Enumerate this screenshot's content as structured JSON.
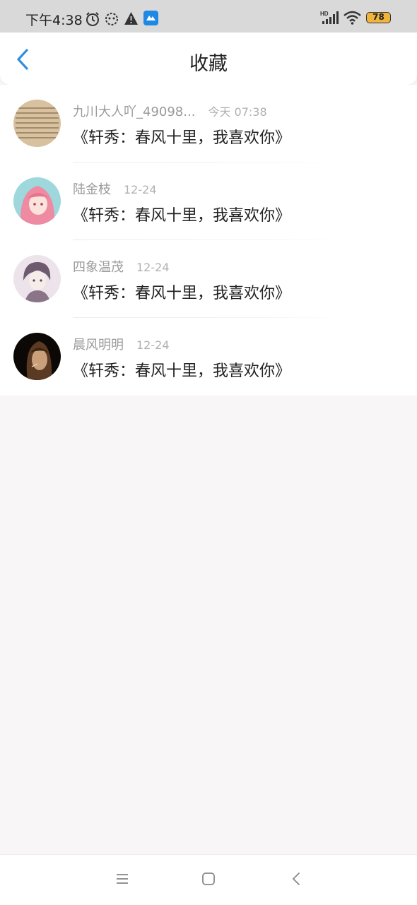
{
  "status_bar": {
    "time": "下午4:38",
    "battery": "78",
    "icons": [
      "alarm-icon",
      "settings-bot-icon",
      "warning-icon",
      "app-notification-icon",
      "hd-signal-icon",
      "wifi-icon",
      "battery-icon"
    ]
  },
  "header": {
    "title": "收藏",
    "back_icon": "chevron-left-icon"
  },
  "favorites": [
    {
      "author": "九川大人吖_49098...",
      "time": "今天 07:38",
      "content": "《轩秀：春风十里，我喜欢你》"
    },
    {
      "author": "陆金枝",
      "time": "12-24",
      "content": "《轩秀：春风十里，我喜欢你》"
    },
    {
      "author": "四象温茂",
      "time": "12-24",
      "content": "《轩秀：春风十里，我喜欢你》"
    },
    {
      "author": "晨风明明",
      "time": "12-24",
      "content": "《轩秀：春风十里，我喜欢你》"
    }
  ],
  "nav_bar": {
    "icons": [
      "menu-icon",
      "home-icon",
      "back-icon"
    ]
  },
  "colors": {
    "accent": "#2f8fe0",
    "background": "#f8f6f7",
    "status_bar": "#d9d9d9",
    "battery": "#f0b43a"
  }
}
